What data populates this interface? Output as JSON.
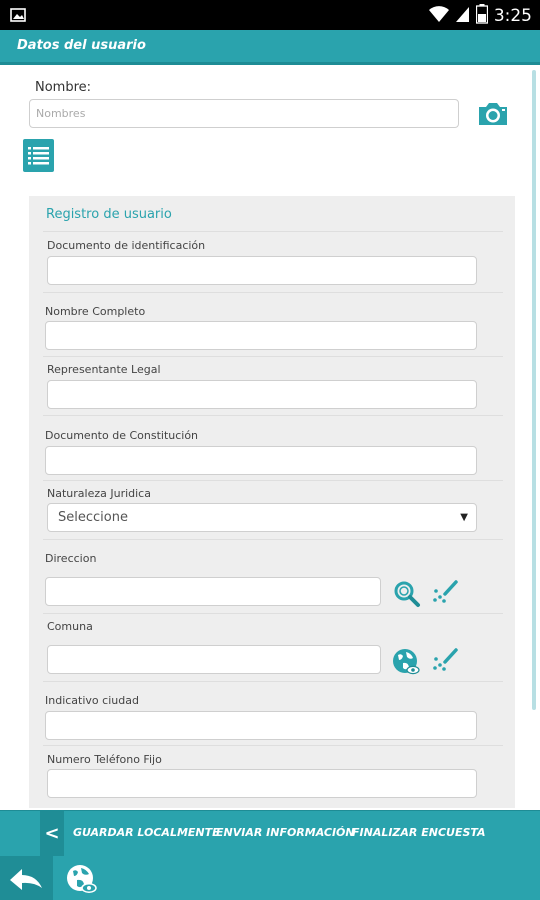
{
  "status_bar": {
    "time": "3:25",
    "icons": [
      "picture-icon",
      "wifi-icon",
      "signal-icon",
      "battery-icon"
    ]
  },
  "header": {
    "title": "Datos del usuario"
  },
  "nombre": {
    "label": "Nombre:",
    "placeholder": "Nombres",
    "value": ""
  },
  "form": {
    "title": "Registro de usuario",
    "fields": [
      {
        "label": "Documento de identificación",
        "value": ""
      },
      {
        "label": "Nombre Completo",
        "value": ""
      },
      {
        "label": "Representante Legal",
        "value": ""
      },
      {
        "label": "Documento de Constitución",
        "value": ""
      },
      {
        "label": "Naturaleza Juridica",
        "value": "Seleccione"
      },
      {
        "label": "Direccion",
        "value": ""
      },
      {
        "label": "Comuna",
        "value": ""
      },
      {
        "label": "Indicativo ciudad",
        "value": ""
      },
      {
        "label": "Numero Teléfono Fijo",
        "value": ""
      }
    ]
  },
  "actions": {
    "back_glyph": "<",
    "save_local": "GUARDAR LOCALMENTE",
    "send_info": "ENVIAR INFORMACIÓN",
    "finish_survey": "FINALIZAR ENCUESTA"
  },
  "colors": {
    "accent": "#2aa3ad",
    "accent_dark": "#1f8d96",
    "panel": "#eeeeee"
  }
}
